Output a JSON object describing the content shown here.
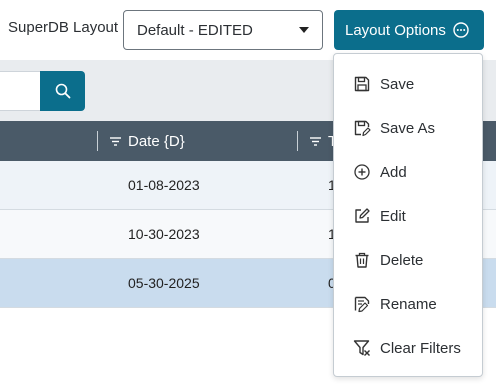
{
  "header": {
    "layout_label": "SuperDB Layout",
    "layout_select_value": "Default - EDITED",
    "layout_options_label": "Layout Options"
  },
  "table": {
    "columns": [
      {
        "label": "Date {D}"
      },
      {
        "label": "T"
      }
    ],
    "rows": [
      {
        "date": "01-08-2023",
        "next": "1"
      },
      {
        "date": "10-30-2023",
        "next": "1"
      },
      {
        "date": "05-30-2025",
        "next": "0"
      }
    ]
  },
  "menu": {
    "items": [
      {
        "label": "Save",
        "icon": "save-icon"
      },
      {
        "label": "Save As",
        "icon": "save-as-icon"
      },
      {
        "label": "Add",
        "icon": "add-circle-icon"
      },
      {
        "label": "Edit",
        "icon": "edit-icon"
      },
      {
        "label": "Delete",
        "icon": "trash-icon"
      },
      {
        "label": "Rename",
        "icon": "rename-icon"
      },
      {
        "label": "Clear Filters",
        "icon": "clear-filter-icon"
      }
    ]
  },
  "colors": {
    "accent": "#0b6e8c",
    "header_bg": "#4a5a68",
    "selected_row": "#c9dcee"
  }
}
